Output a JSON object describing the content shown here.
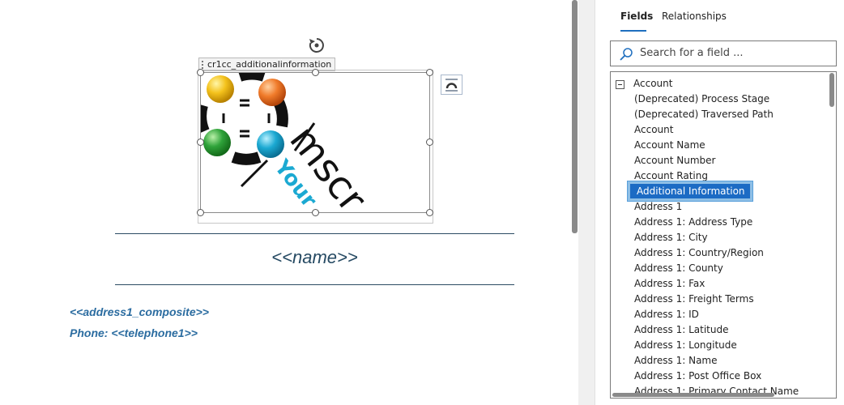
{
  "document": {
    "image_tag": "cr1cc_additionalinformation",
    "logo_text": "mscr",
    "logo_tagline": "Your",
    "name_field": "<<name>>",
    "address_field": "<<address1_composite>>",
    "phone_field": "Phone: <<telephone1>>"
  },
  "panel": {
    "tabs": [
      {
        "label": "Fields",
        "active": true
      },
      {
        "label": "Relationships",
        "active": false
      }
    ],
    "search": {
      "placeholder": "Search for a field ..."
    },
    "tree": {
      "root": "Account",
      "items": [
        "(Deprecated) Process Stage",
        "(Deprecated) Traversed Path",
        "Account",
        "Account Name",
        "Account Number",
        "Account Rating",
        "Additional Information",
        "Address 1",
        "Address 1: Address Type",
        "Address 1: City",
        "Address 1: Country/Region",
        "Address 1: County",
        "Address 1: Fax",
        "Address 1: Freight Terms",
        "Address 1: ID",
        "Address 1: Latitude",
        "Address 1: Longitude",
        "Address 1: Name",
        "Address 1: Post Office Box",
        "Address 1: Primary Contact Name"
      ],
      "selected_index": 6
    }
  },
  "colors": {
    "accent": "#1c6bc4",
    "field_text": "#2b6ca0",
    "name_text": "#264a63"
  }
}
